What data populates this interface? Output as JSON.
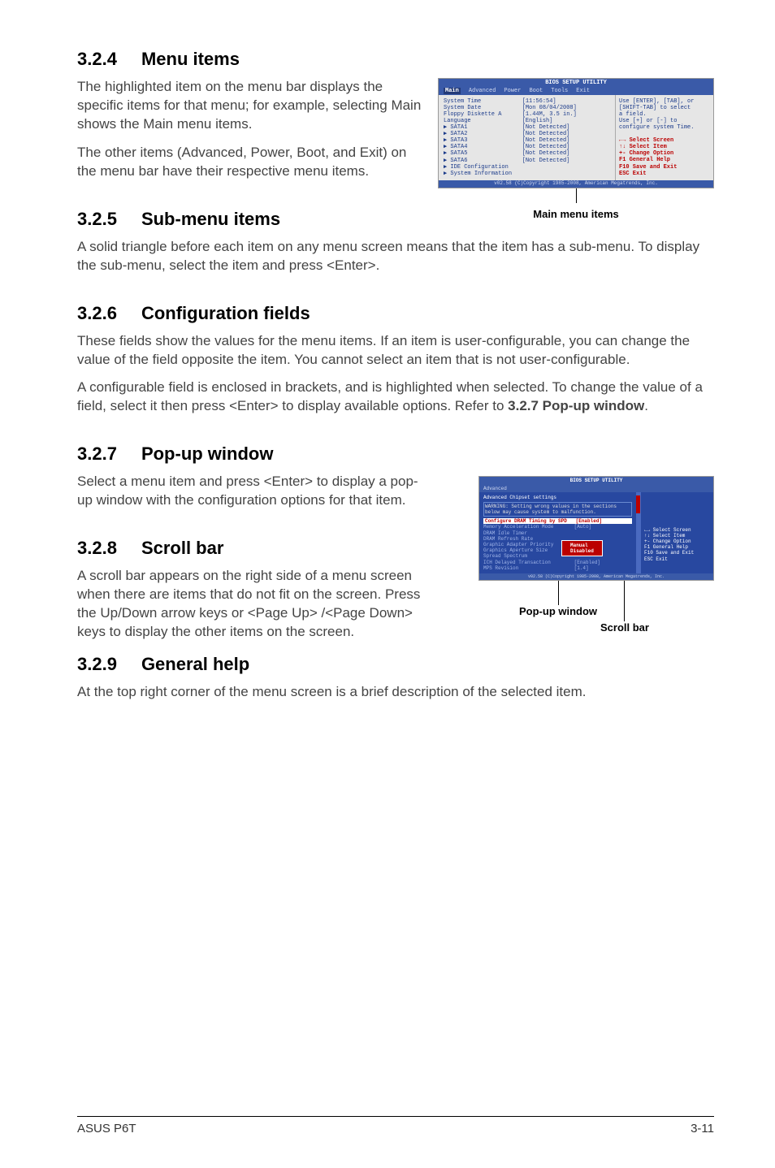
{
  "sections": {
    "s324": {
      "num": "3.2.4",
      "title": "Menu items",
      "p1": "The highlighted item on the menu bar displays the specific items for that menu; for example, selecting Main shows the Main menu items.",
      "p2": "The other items (Advanced, Power, Boot, and Exit) on the menu bar have their respective menu items."
    },
    "s325": {
      "num": "3.2.5",
      "title": "Sub-menu items",
      "p1": "A solid triangle before each item on any menu screen means that the item has a sub-menu. To display the sub-menu, select the item and press <Enter>."
    },
    "s326": {
      "num": "3.2.6",
      "title": "Configuration fields",
      "p1": "These fields show the values for the menu items. If an item is user-configurable, you can change the value of the field opposite the item. You cannot select an item that is not user-configurable.",
      "p2a": "A configurable field is enclosed in brackets, and is highlighted when selected. To change the value of a field, select it then press <Enter> to display available options. Refer to ",
      "p2b": "3.2.7 Pop-up window",
      "p2c": "."
    },
    "s327": {
      "num": "3.2.7",
      "title": "Pop-up window",
      "p1": "Select a menu item and press <Enter> to display a pop-up window with the configuration options for that item."
    },
    "s328": {
      "num": "3.2.8",
      "title": "Scroll bar",
      "p1": "A scroll bar appears on the right side of a menu screen when there are items that do not fit on the screen. Press the Up/Down arrow keys or <Page Up> /<Page Down> keys to display the other items on the screen."
    },
    "s329": {
      "num": "3.2.9",
      "title": "General help",
      "p1": "At the top right corner of the menu screen is a brief description of the selected item."
    }
  },
  "fig1": {
    "caption": "Main menu items",
    "titlebar": "BIOS SETUP UTILITY",
    "menubar": [
      "Main",
      "Advanced",
      "Power",
      "Boot",
      "Tools",
      "Exit"
    ],
    "left_items": [
      "System Time            [11:56:54]",
      "System Date            [Mon 08/04/2008]",
      "Floppy Diskette A      [1.44M, 3.5 in.]",
      "Language               [English]",
      "",
      "▶ SATA1                [Not Detected]",
      "▶ SATA2                [Not Detected]",
      "▶ SATA3                [Not Detected]",
      "▶ SATA4                [Not Detected]",
      "▶ SATA5                [Not Detected]",
      "▶ SATA6                [Not Detected]",
      "",
      "▶ IDE Configuration",
      "▶ System Information"
    ],
    "right_help": [
      "Use [ENTER], [TAB], or",
      "[SHIFT-TAB] to select",
      "a field.",
      "",
      "Use [+] or [-] to",
      "configure system Time."
    ],
    "right_keys": [
      "←→    Select Screen",
      "↑↓    Select Item",
      "+-    Change Option",
      "F1    General Help",
      "F10   Save and Exit",
      "ESC   Exit"
    ],
    "footer": "v02.58 (C)Copyright 1985-2008, American Megatrends, Inc."
  },
  "fig2": {
    "titlebar": "BIOS SETUP UTILITY",
    "tab": "Advanced",
    "heading": "Advanced Chipset settings",
    "warning": "WARNING: Setting wrong values in the sections below may cause system to malfunction.",
    "items": [
      "Configure DRAM Timing by SPD   [Enabled]",
      "Memory Acceleration Mode       [Auto]",
      "DRAM Idle Timer",
      "DRAM Refresh Rate",
      "",
      "Graphic Adapter Priority",
      "Graphics Aperture Size         [Disabled]",
      "Spread Spectrum",
      "",
      "ICH Delayed Transaction        [Enabled]",
      "",
      "MPS Revision                   [1.4]"
    ],
    "popup": [
      "Manual",
      "Disabled"
    ],
    "right_keys": [
      "←→  Select Screen",
      "↑↓  Select Item",
      "+-  Change Option",
      "F1  General Help",
      "F10 Save and Exit",
      "ESC Exit"
    ],
    "footer": "v02.58 (C)Copyright 1985-2008, American Megatrends, Inc.",
    "label_popup": "Pop-up window",
    "label_scroll": "Scroll bar"
  },
  "page_footer": {
    "left": "ASUS P6T",
    "right": "3-11"
  }
}
